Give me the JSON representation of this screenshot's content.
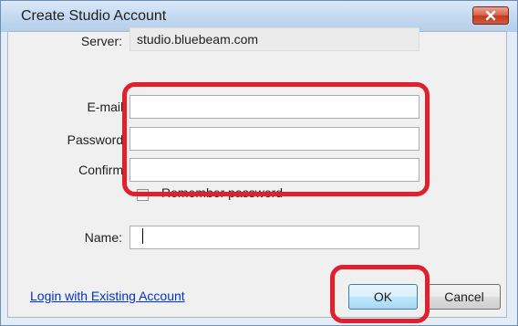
{
  "window": {
    "title": "Create Studio Account",
    "close_icon": "close-x-icon"
  },
  "form": {
    "server_label": "Server:",
    "server_value": "studio.bluebeam.com",
    "email_label": "E-mail:",
    "email_value": "",
    "password_label": "Password:",
    "password_value": "",
    "confirm_label": "Confirm:",
    "confirm_value": "",
    "remember_label": "Remember password",
    "remember_checked": false,
    "name_label": "Name:",
    "name_value": ""
  },
  "footer": {
    "login_link": "Login with Existing Account",
    "ok_label": "OK",
    "cancel_label": "Cancel"
  },
  "colors": {
    "highlight": "#e0202c",
    "close_button": "#c9452b",
    "link": "#0033cc"
  }
}
